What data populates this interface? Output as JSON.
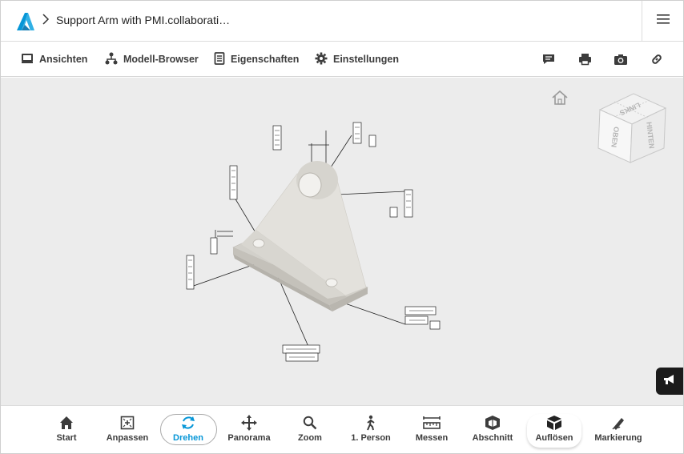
{
  "header": {
    "title": "Support Arm with PMI.collaborati…",
    "logo_icon": "autodesk-logo-icon",
    "menu_icon": "hamburger-menu-icon"
  },
  "toolbar": {
    "items": [
      {
        "label": "Ansichten",
        "icon": "monitor-icon"
      },
      {
        "label": "Modell-Browser",
        "icon": "model-tree-icon"
      },
      {
        "label": "Eigenschaften",
        "icon": "document-icon"
      },
      {
        "label": "Einstellungen",
        "icon": "gear-icon"
      }
    ],
    "right_icons": [
      "comment-icon",
      "print-icon",
      "camera-icon",
      "link-icon"
    ]
  },
  "viewcube": {
    "faces": {
      "top": "LINKS",
      "left": "OBEN",
      "right": "HINTEN"
    }
  },
  "bottom_toolbar": {
    "items": [
      {
        "label": "Start",
        "icon": "home-icon"
      },
      {
        "label": "Anpassen",
        "icon": "fit-icon"
      },
      {
        "label": "Drehen",
        "icon": "orbit-icon",
        "active": true
      },
      {
        "label": "Panorama",
        "icon": "pan-icon"
      },
      {
        "label": "Zoom",
        "icon": "zoom-icon"
      },
      {
        "label": "1. Person",
        "icon": "walk-icon"
      },
      {
        "label": "Messen",
        "icon": "measure-icon"
      },
      {
        "label": "Abschnitt",
        "icon": "section-icon"
      },
      {
        "label": "Auflösen",
        "icon": "explode-icon"
      },
      {
        "label": "Markierung",
        "icon": "markup-icon"
      }
    ]
  },
  "colors": {
    "accent": "#0696d7",
    "viewport_bg": "#ececec",
    "part_fill": "#e4e2dd"
  }
}
